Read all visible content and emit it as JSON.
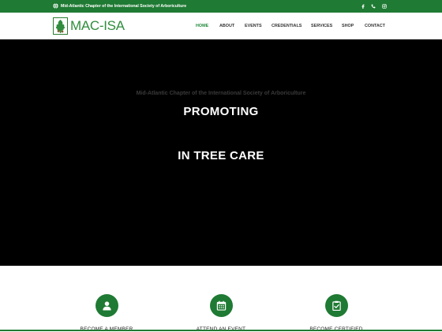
{
  "topbar": {
    "tagline": "Mid-Atlantic Chapter of the International Society of Arboriculture",
    "icons": [
      "globe-icon",
      "facebook-icon",
      "phone-icon",
      "instagram-icon"
    ]
  },
  "header": {
    "logo_text": "MAC-ISA",
    "nav": [
      {
        "label": "HOME",
        "active": true
      },
      {
        "label": "ABOUT",
        "active": false
      },
      {
        "label": "EVENTS",
        "active": false
      },
      {
        "label": "CREDENTIALS",
        "active": false
      },
      {
        "label": "SERVICES",
        "active": false
      },
      {
        "label": "SHOP",
        "active": false
      },
      {
        "label": "CONTACT",
        "active": false
      }
    ]
  },
  "hero": {
    "kicker": "Mid-Atlantic Chapter of the International Society of Arboriculture",
    "line1": "PROMOTING",
    "line2": "IN TREE CARE"
  },
  "features": [
    {
      "icon": "user-icon",
      "label": "BECOME A MEMBER"
    },
    {
      "icon": "calendar-icon",
      "label": "ATTEND AN EVENT"
    },
    {
      "icon": "clipboard-check-icon",
      "label": "BECOME CERTIFIED"
    }
  ],
  "colors": {
    "brand_green": "#1f7a33",
    "nav_active": "#1f8a3b",
    "hero_bg": "#000000"
  }
}
